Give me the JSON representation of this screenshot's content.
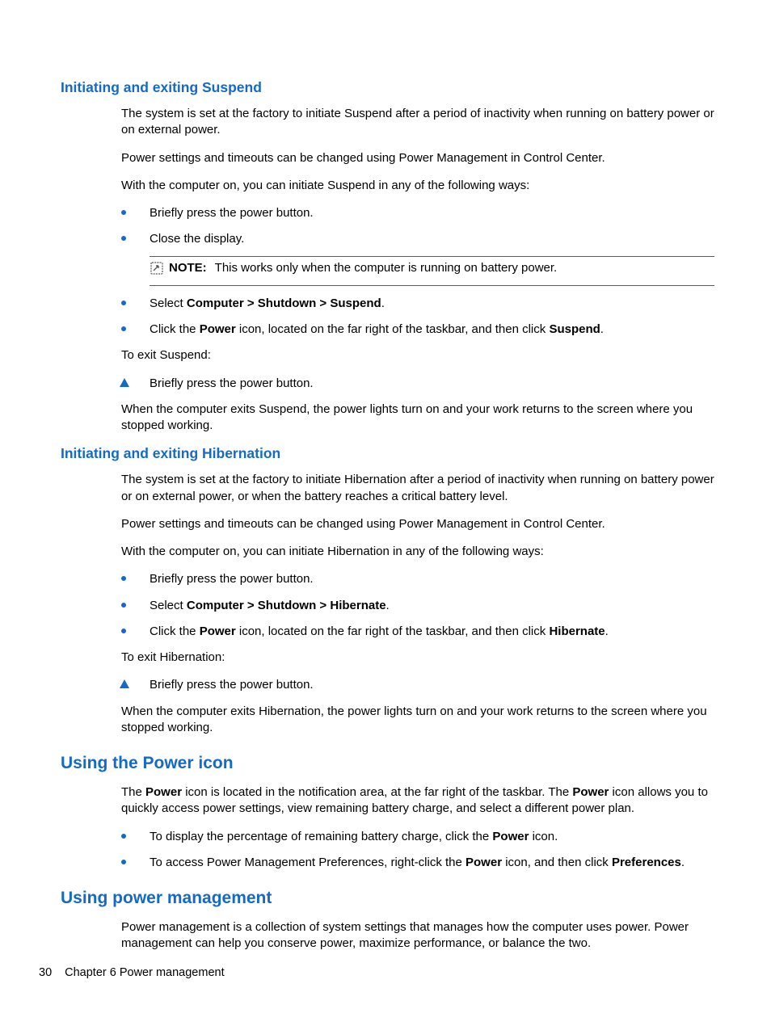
{
  "section1": {
    "heading": "Initiating and exiting Suspend",
    "p1": "The system is set at the factory to initiate Suspend after a period of inactivity when running on battery power or on external power.",
    "p2": "Power settings and timeouts can be changed using Power Management in Control Center.",
    "p3": "With the computer on, you can initiate Suspend in any of the following ways:",
    "b1": "Briefly press the power button.",
    "b2": "Close the display.",
    "note_label": "NOTE:",
    "note_text": "This works only when the computer is running on battery power.",
    "b3_pre": "Select ",
    "b3_bold": "Computer > Shutdown > Suspend",
    "b3_post": ".",
    "b4_pre": "Click the ",
    "b4_bold1": "Power",
    "b4_mid": " icon, located on the far right of the taskbar, and then click ",
    "b4_bold2": "Suspend",
    "b4_post": ".",
    "p4": "To exit Suspend:",
    "t1": "Briefly press the power button.",
    "p5": "When the computer exits Suspend, the power lights turn on and your work returns to the screen where you stopped working."
  },
  "section2": {
    "heading": "Initiating and exiting Hibernation",
    "p1": "The system is set at the factory to initiate Hibernation after a period of inactivity when running on battery power or on external power, or when the battery reaches a critical battery level.",
    "p2": "Power settings and timeouts can be changed using Power Management in Control Center.",
    "p3": "With the computer on, you can initiate Hibernation in any of the following ways:",
    "b1": "Briefly press the power button.",
    "b2_pre": "Select ",
    "b2_bold": "Computer > Shutdown > Hibernate",
    "b2_post": ".",
    "b3_pre": "Click the ",
    "b3_bold1": "Power",
    "b3_mid": " icon, located on the far right of the taskbar, and then click ",
    "b3_bold2": "Hibernate",
    "b3_post": ".",
    "p4": "To exit Hibernation:",
    "t1": "Briefly press the power button.",
    "p5": "When the computer exits Hibernation, the power lights turn on and your work returns to the screen where you stopped working."
  },
  "section3": {
    "heading": "Using the Power icon",
    "p1_pre": "The ",
    "p1_b1": "Power",
    "p1_mid": " icon is located in the notification area, at the far right of the taskbar. The ",
    "p1_b2": "Power",
    "p1_post": " icon allows you to quickly access power settings, view remaining battery charge, and select a different power plan.",
    "b1_pre": "To display the percentage of remaining battery charge, click the ",
    "b1_bold": "Power",
    "b1_post": " icon.",
    "b2_pre": "To access Power Management Preferences, right-click the ",
    "b2_bold1": "Power",
    "b2_mid": " icon, and then click ",
    "b2_bold2": "Preferences",
    "b2_post": "."
  },
  "section4": {
    "heading": "Using power management",
    "p1": "Power management is a collection of system settings that manages how the computer uses power. Power management can help you conserve power, maximize performance, or balance the two."
  },
  "footer": {
    "page_number": "30",
    "chapter": "Chapter 6   Power management"
  }
}
